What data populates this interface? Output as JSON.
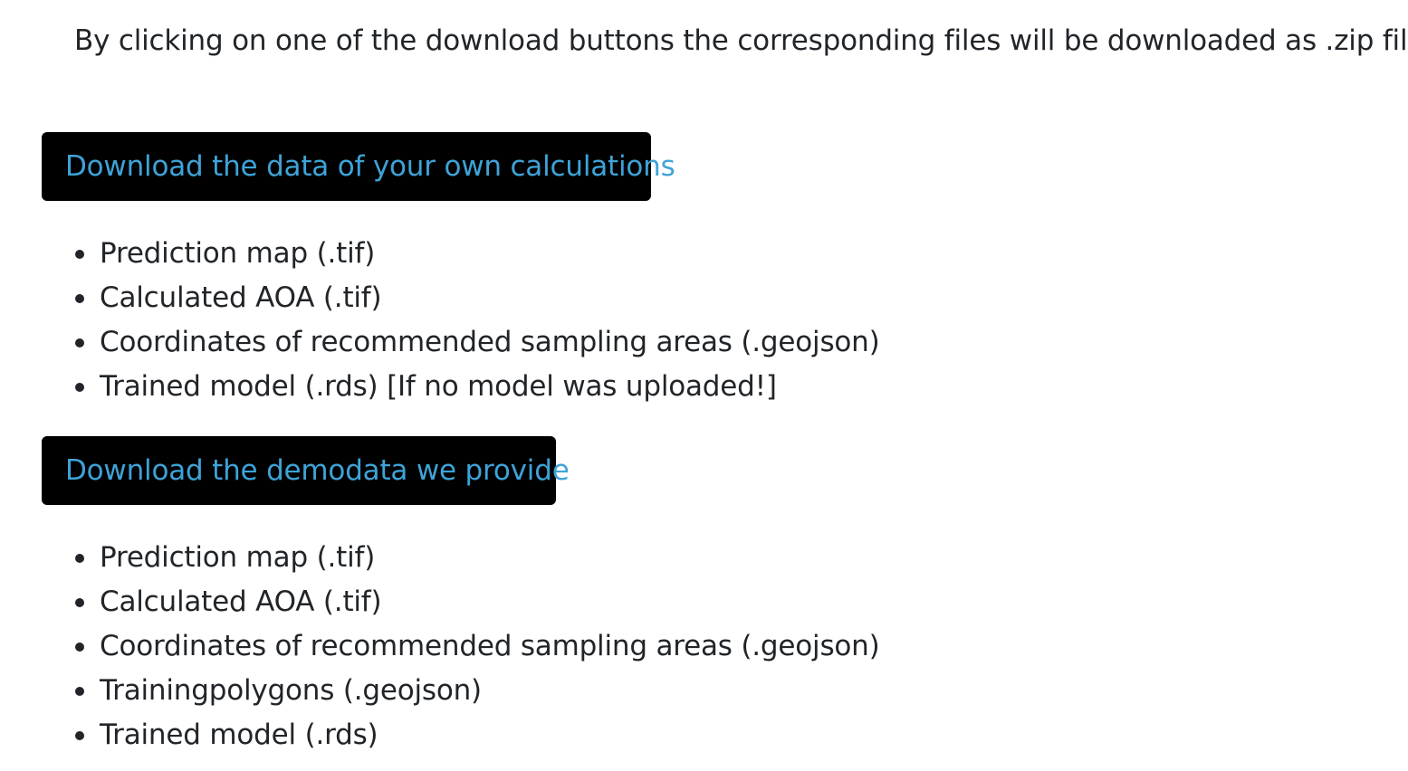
{
  "intro_text": "By clicking on one of the download buttons the corresponding files will be downloaded as .zip file.",
  "own": {
    "button_label": "Download the data of your own calculations",
    "items": [
      "Prediction map (.tif)",
      "Calculated AOA (.tif)",
      "Coordinates of recommended sampling areas (.geojson)",
      "Trained model (.rds) [If no model was uploaded!]"
    ]
  },
  "demo": {
    "button_label": "Download the demodata we provide",
    "items": [
      "Prediction map (.tif)",
      "Calculated AOA (.tif)",
      "Coordinates of recommended sampling areas (.geojson)",
      "Trainingpolygons (.geojson)",
      "Trained model (.rds)"
    ]
  },
  "colors": {
    "button_background": "#000000",
    "button_text": "#3ea3d8",
    "body_text": "#212529"
  }
}
